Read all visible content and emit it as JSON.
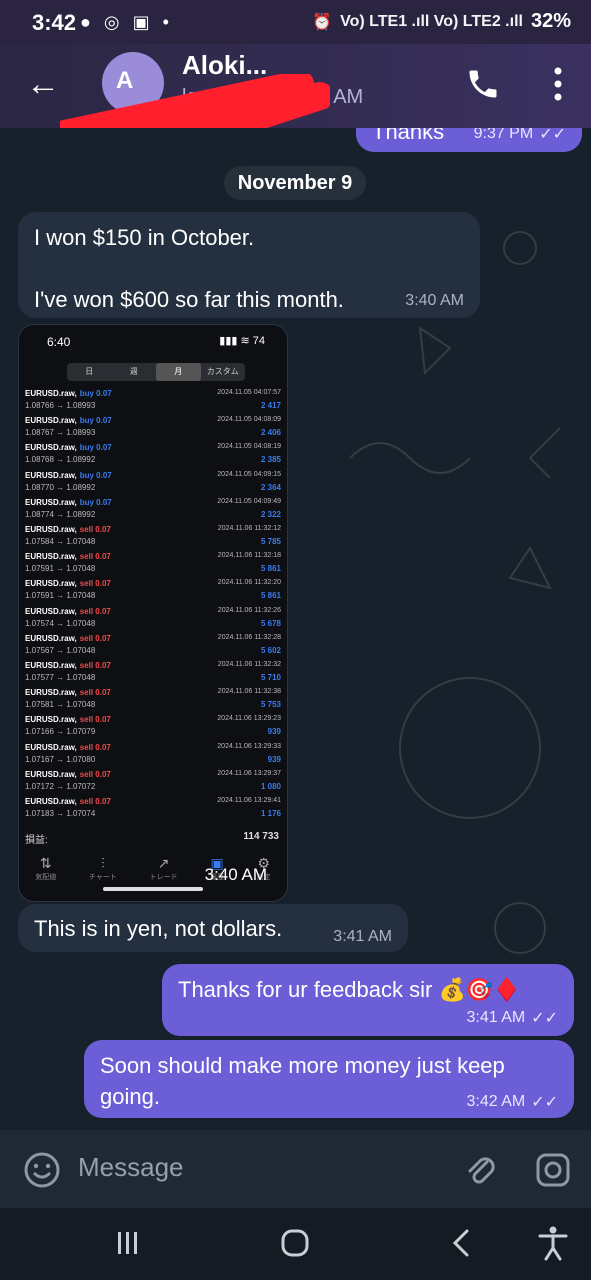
{
  "status_bar": {
    "time": "3:42",
    "network": "Vo) LTE1 .ıll Vo) LTE2 .ıll",
    "battery": "32%"
  },
  "header": {
    "contact_name": "Aloki...",
    "avatar_initials": "A",
    "last_seen": "last seen at 3:42 AM"
  },
  "chat": {
    "date_label": "November 9",
    "messages": [
      {
        "direction": "out",
        "text": "Thanks",
        "time": "9:37 PM"
      },
      {
        "direction": "in",
        "text": "I won $150 in October.\n\nI've won $600 so far this month.",
        "time": "3:40 AM"
      },
      {
        "direction": "in",
        "text": "This is in yen, not dollars.",
        "time": "3:41 AM"
      },
      {
        "direction": "out",
        "text": "Thanks for ur feedback sir 💰🎯♦️",
        "time": "3:41 AM"
      },
      {
        "direction": "out",
        "text": "Soon should make more money just keep going.",
        "time": "3:42 AM"
      }
    ],
    "screenshot": {
      "time_label": "3:40 AM",
      "phone_time": "6:40",
      "tabs": [
        "日",
        "週",
        "月",
        "カスタム"
      ],
      "active_tab": "月",
      "rows": [
        {
          "pair": "EURUSD.raw,",
          "side": "buy 0.07",
          "type": "buy",
          "date": "2024.11.05 04:07:57",
          "prices": "1.08766 → 1.08993",
          "profit": "2 417"
        },
        {
          "pair": "EURUSD.raw,",
          "side": "buy 0.07",
          "type": "buy",
          "date": "2024.11.05 04:08:09",
          "prices": "1.08767 → 1.08993",
          "profit": "2 406"
        },
        {
          "pair": "EURUSD.raw,",
          "side": "buy 0.07",
          "type": "buy",
          "date": "2024.11.05 04:08:19",
          "prices": "1.08768 → 1.08992",
          "profit": "2 385"
        },
        {
          "pair": "EURUSD.raw,",
          "side": "buy 0.07",
          "type": "buy",
          "date": "2024.11.05 04:09:15",
          "prices": "1.08770 → 1.08992",
          "profit": "2 364"
        },
        {
          "pair": "EURUSD.raw,",
          "side": "buy 0.07",
          "type": "buy",
          "date": "2024.11.05 04:09:49",
          "prices": "1.08774 → 1.08992",
          "profit": "2 322"
        },
        {
          "pair": "EURUSD.raw,",
          "side": "sell 0.07",
          "type": "sell",
          "date": "2024.11.06 11:32:12",
          "prices": "1.07584 → 1.07048",
          "profit": "5 785"
        },
        {
          "pair": "EURUSD.raw,",
          "side": "sell 0.07",
          "type": "sell",
          "date": "2024.11.06 11:32:18",
          "prices": "1.07591 → 1.07048",
          "profit": "5 861"
        },
        {
          "pair": "EURUSD.raw,",
          "side": "sell 0.07",
          "type": "sell",
          "date": "2024.11.06 11:32:20",
          "prices": "1.07591 → 1.07048",
          "profit": "5 861"
        },
        {
          "pair": "EURUSD.raw,",
          "side": "sell 0.07",
          "type": "sell",
          "date": "2024.11.06 11:32:26",
          "prices": "1.07574 → 1.07048",
          "profit": "5 678"
        },
        {
          "pair": "EURUSD.raw,",
          "side": "sell 0.07",
          "type": "sell",
          "date": "2024.11.06 11:32:28",
          "prices": "1.07567 → 1.07048",
          "profit": "5 602"
        },
        {
          "pair": "EURUSD.raw,",
          "side": "sell 0.07",
          "type": "sell",
          "date": "2024.11.06 11:32:32",
          "prices": "1.07577 → 1.07048",
          "profit": "5 710"
        },
        {
          "pair": "EURUSD.raw,",
          "side": "sell 0.07",
          "type": "sell",
          "date": "2024.11.06 11:32:38",
          "prices": "1.07581 → 1.07048",
          "profit": "5 753"
        },
        {
          "pair": "EURUSD.raw,",
          "side": "sell 0.07",
          "type": "sell",
          "date": "2024.11.06 13:29:23",
          "prices": "1.07166 → 1.07079",
          "profit": "939"
        },
        {
          "pair": "EURUSD.raw,",
          "side": "sell 0.07",
          "type": "sell",
          "date": "2024.11.06 13:29:33",
          "prices": "1.07167 → 1.07080",
          "profit": "939"
        },
        {
          "pair": "EURUSD.raw,",
          "side": "sell 0.07",
          "type": "sell",
          "date": "2024.11.06 13:29:37",
          "prices": "1.07172 → 1.07072",
          "profit": "1 080"
        },
        {
          "pair": "EURUSD.raw,",
          "side": "sell 0.07",
          "type": "sell",
          "date": "2024.11.06 13:29:41",
          "prices": "1.07183 → 1.07074",
          "profit": "1 176"
        }
      ],
      "profit_label": "損益:",
      "profit_total": "114 733",
      "nav_items": [
        "気配値",
        "チャート",
        "トレード",
        "履歴",
        "設定"
      ]
    }
  },
  "input": {
    "placeholder": "Message"
  },
  "colors": {
    "accent_out": "#6b5ed6",
    "incoming": "#243040",
    "header": "#2b2642"
  }
}
